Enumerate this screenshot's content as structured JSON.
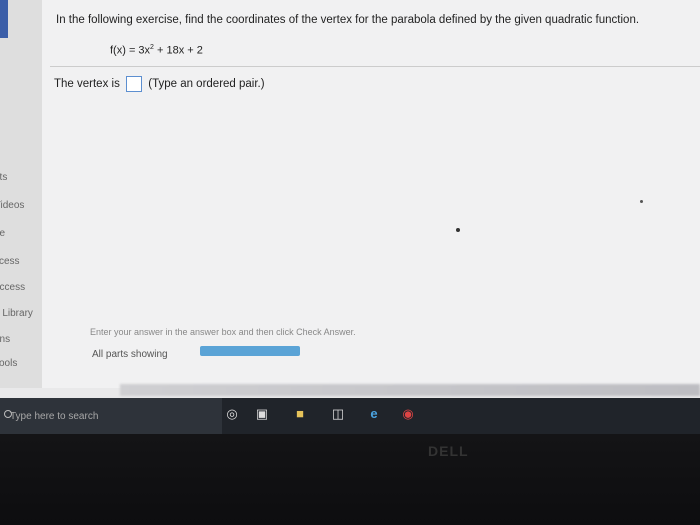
{
  "question": {
    "prompt": "In the following exercise, find the coordinates of the vertex for the parabola defined by the given quadratic function.",
    "function_prefix": "f(x) = 3x",
    "function_exponent": "2",
    "function_suffix": " + 18x + 2",
    "answer_label": "The vertex is",
    "answer_value": "",
    "answer_hint": "(Type an ordered pair.)"
  },
  "sidebar": {
    "items": [
      {
        "label": "nts"
      },
      {
        "label": "Videos"
      },
      {
        "label": "de"
      },
      {
        "label": "ccess"
      },
      {
        "label": "uccess"
      },
      {
        "label": "a Library"
      },
      {
        "label": "ons"
      },
      {
        "label": "Tools"
      }
    ]
  },
  "footer": {
    "instruction": "Enter your answer in the answer box and then click Check Answer.",
    "parts_label": "All parts showing",
    "progress_fraction": 1.0
  },
  "taskbar": {
    "search_placeholder": "Type here to search",
    "icons": [
      "microphone-icon",
      "task-view-icon",
      "file-explorer-icon",
      "store-icon",
      "edge-icon",
      "chrome-icon"
    ]
  },
  "colors": {
    "accent": "#3b5ea8",
    "progress": "#5aa3d6",
    "answer_box_border": "#5d8fd0"
  }
}
